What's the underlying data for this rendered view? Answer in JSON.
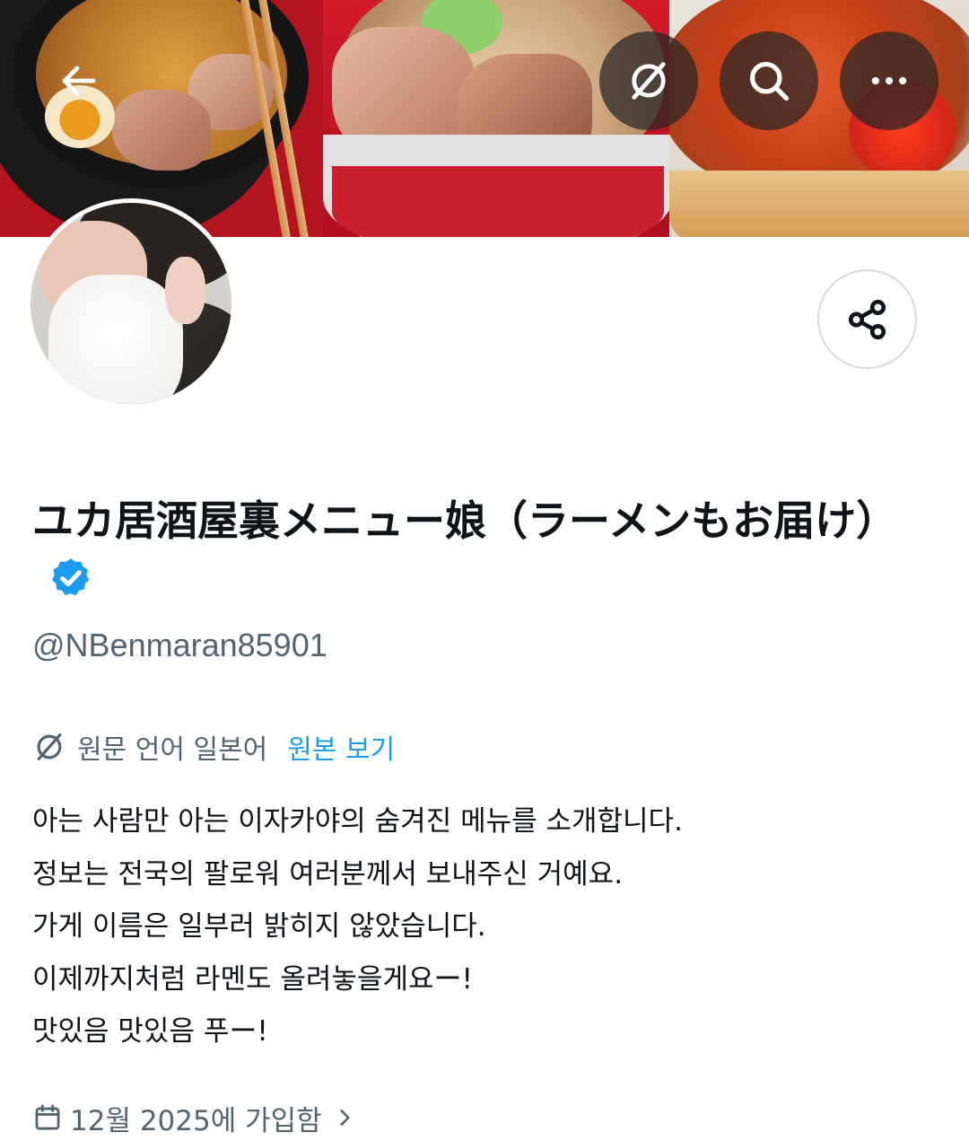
{
  "header": {
    "back_icon": "arrow-left-icon",
    "translate_icon": "translate-off-icon",
    "search_icon": "search-icon",
    "more_icon": "more-horizontal-icon"
  },
  "profile": {
    "display_name": "ユカ居酒屋裏メニュー娘（ラーメンもお届け）",
    "verified_badge": "verified-icon",
    "verified_color": "#1d9bf0",
    "handle": "@NBenmaran85901",
    "share_icon": "share-icon"
  },
  "translation": {
    "icon": "translate-off-icon",
    "source_language_text": "원문 언어 일본어",
    "view_original_label": "원본 보기"
  },
  "bio": {
    "lines": [
      "아는 사람만 아는 이자카야의 숨겨진 메뉴를 소개합니다.",
      "정보는 전국의 팔로워 여러분께서 보내주신 거예요.",
      "가게 이름은 일부러 밝히지 않았습니다.",
      "이제까지처럼 라멘도 올려놓을게요ー!",
      "맛있음 맛있음 푸ー!"
    ]
  },
  "joined": {
    "icon": "calendar-icon",
    "text": "12월 2025에 가입함",
    "chevron_icon": "chevron-right-icon"
  },
  "colors": {
    "primary_text": "#0f1419",
    "secondary_text": "#536471",
    "link": "#1d9bf0",
    "border": "#d6dadd"
  }
}
